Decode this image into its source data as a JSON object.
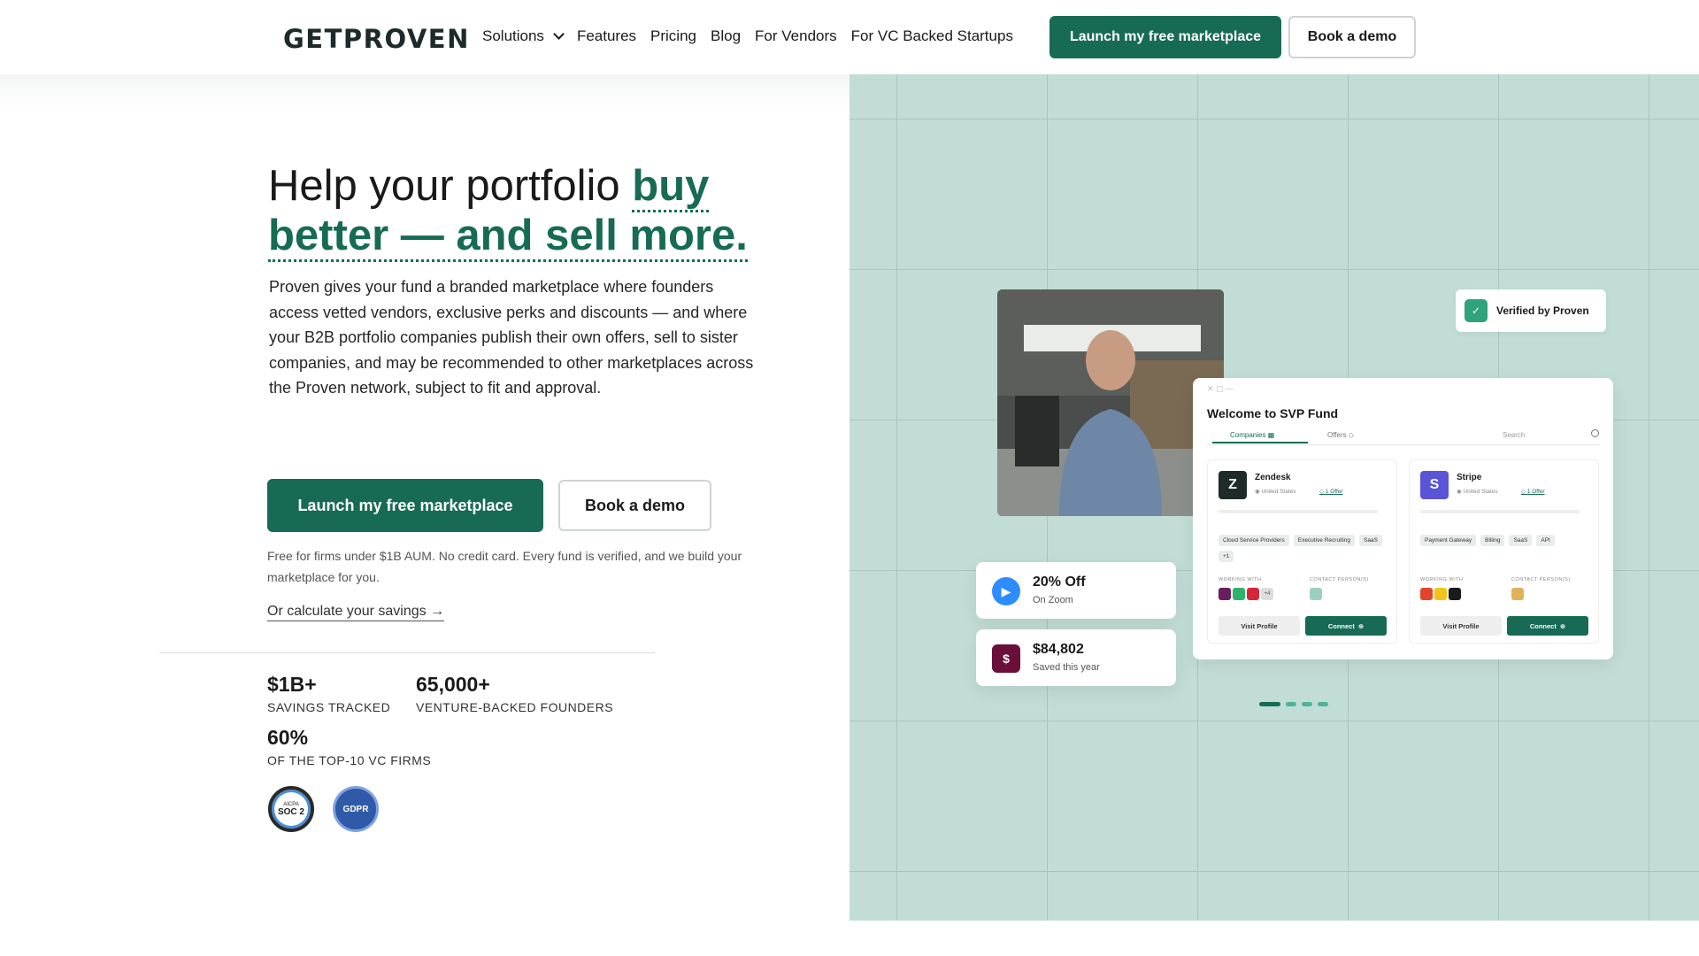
{
  "nav": {
    "logo": "GETPROVEN",
    "links": [
      "Solutions",
      "Features",
      "Pricing",
      "Blog",
      "For Vendors",
      "For VC Backed Startups"
    ],
    "cta_primary": "Launch my free marketplace",
    "cta_secondary": "Book a demo"
  },
  "hero": {
    "headline_plain": "Help your portfolio ",
    "headline_accent_1": "buy",
    "headline_accent_2": "better — and sell more.",
    "body": "Proven gives your fund a branded marketplace where founders access vetted vendors, exclusive perks and discounts — and where your B2B portfolio companies publish their own offers, sell to sister companies, and may be recommended to other marketplaces across the Proven network, subject to fit and approval.",
    "cta_primary": "Launch my free marketplace",
    "cta_secondary": "Book a demo",
    "fine_print": "Free for firms under $1B AUM. No credit card. Every fund is verified, and we build your marketplace for you.",
    "calc_link": "Or calculate your savings →"
  },
  "stats": [
    {
      "value": "$1B+",
      "label": "SAVINGS TRACKED"
    },
    {
      "value": "65,000+",
      "label": "VENTURE-BACKED FOUNDERS"
    },
    {
      "value": "60%",
      "label": "OF THE TOP-10 VC FIRMS"
    }
  ],
  "badges": {
    "soc_top": "AICPA",
    "soc_main": "SOC 2",
    "gdpr": "GDPR"
  },
  "preview": {
    "verified": "Verified by Proven",
    "app_title": "Welcome to SVP Fund",
    "tabs": [
      "Companies",
      "Offers"
    ],
    "search": "Search",
    "cards": [
      {
        "logo_letter": "Z",
        "name": "Zendesk",
        "location": "United States",
        "offer": "1 Offer",
        "tags": [
          "Cloud Service Providers",
          "Executive Recruiting",
          "SaaS",
          "+1"
        ],
        "working_with": "WORKING WITH",
        "contact": "CONTACT PERSON(S)",
        "more": "+4",
        "visit": "Visit Profile",
        "connect": "Connect"
      },
      {
        "logo_letter": "S",
        "name": "Stripe",
        "location": "United States",
        "offer": "1 Offer",
        "tags": [
          "Payment Gateway",
          "Billing",
          "SaaS",
          "API"
        ],
        "working_with": "WORKING WITH",
        "contact": "CONTACT PERSON(S)",
        "visit": "Visit Profile",
        "connect": "Connect"
      }
    ],
    "float_zoom": {
      "value": "20% Off",
      "sub": "On Zoom"
    },
    "float_saved": {
      "value": "$84,802",
      "sub": "Saved this year"
    }
  },
  "colors": {
    "brand": "#176b55",
    "panel": "#c2ddd6",
    "zendesk": "#1f2a2a",
    "stripe": "#5a54d6",
    "zoom": "#2d8cff",
    "savings": "#6b0f3a"
  }
}
